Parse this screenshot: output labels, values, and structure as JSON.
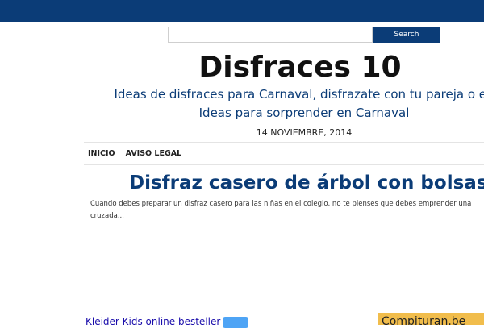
{
  "colors": {
    "brand": "#0b3c77",
    "ad_button": "#4ea4f5",
    "ad_banner": "#f1bd4c"
  },
  "search": {
    "placeholder": "",
    "value": "",
    "button_label": "Search"
  },
  "site": {
    "title": "Disfraces 10",
    "tagline_line1": "Ideas de disfraces para Carnaval, disfrazate con tu pareja o en",
    "tagline_line2": "Ideas para sorprender en Carnaval",
    "date": "14 NOVIEMBRE, 2014"
  },
  "nav": {
    "items": [
      {
        "label": "INICIO"
      },
      {
        "label": "AVISO LEGAL"
      }
    ]
  },
  "post": {
    "title": "Disfraz casero de árbol con bolsas",
    "excerpt_line1": "Cuando debes preparar un disfraz casero para las niñas en el colegio, no te pienses que debes emprender una",
    "excerpt_line2": "cruzada..."
  },
  "ads": {
    "left_text": "Kleider Kids online besteller",
    "right_text": "Compituran.be"
  }
}
